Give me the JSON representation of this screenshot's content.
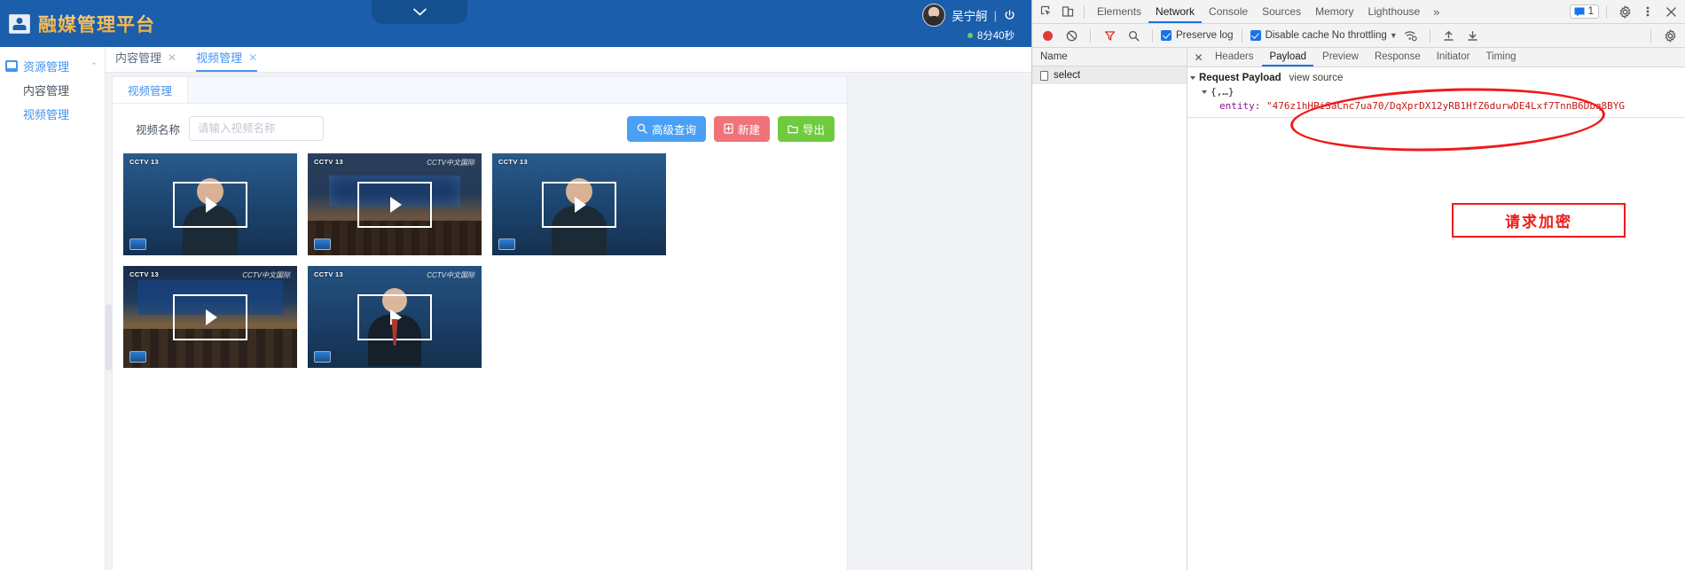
{
  "app": {
    "logo_text": "融媒管理平台",
    "user": {
      "name": "吴宁舸",
      "separator": "|",
      "timer": "8分40秒"
    }
  },
  "sidebar": {
    "group": {
      "label": "资源管理",
      "icon": "resource-icon",
      "chevron": "⌃"
    },
    "items": [
      {
        "label": "内容管理",
        "active": false
      },
      {
        "label": "视频管理",
        "active": true
      }
    ]
  },
  "tabstrip": {
    "tabs": [
      {
        "label": "内容管理",
        "close": "✕",
        "active": false
      },
      {
        "label": "视频管理",
        "close": "✕",
        "active": true
      }
    ]
  },
  "content": {
    "card_tab": "视频管理",
    "filter": {
      "label": "视频名称",
      "placeholder": "请输入视频名称",
      "value": ""
    },
    "buttons": [
      {
        "label": "高级查询",
        "icon": "search-icon",
        "color": "#4aa0f5"
      },
      {
        "label": "新建",
        "icon": "file-plus-icon",
        "color": "#f0737a"
      },
      {
        "label": "导出",
        "icon": "export-folder-icon",
        "color": "#6fcb3e"
      }
    ],
    "videos": [
      {
        "scene": "anchor",
        "cctv": "CCTV 13",
        "watermark": "",
        "play": "play-icon"
      },
      {
        "scene": "hall",
        "cctv": "CCTV 13",
        "watermark": "CCTV中文国际",
        "play": "play-icon"
      },
      {
        "scene": "anchor",
        "cctv": "CCTV 13",
        "watermark": "",
        "play": "play-icon"
      },
      {
        "scene": "stage",
        "cctv": "CCTV 13",
        "watermark": "CCTV中文国际",
        "play": "play-icon"
      },
      {
        "scene": "anchor2",
        "cctv": "CCTV 13",
        "watermark": "CCTV中文国际",
        "play": "play-icon"
      }
    ]
  },
  "devtools": {
    "left_icons": [
      "inspect-icon",
      "device-toolbar-icon"
    ],
    "tabs": [
      {
        "label": "Elements",
        "active": false
      },
      {
        "label": "Network",
        "active": true
      },
      {
        "label": "Console",
        "active": false
      },
      {
        "label": "Sources",
        "active": false
      },
      {
        "label": "Memory",
        "active": false
      },
      {
        "label": "Lighthouse",
        "active": false
      }
    ],
    "more": "»",
    "message_count": "1",
    "settings_icon": "gear-icon",
    "kebab_icon": "kebab-menu-icon",
    "close_icon": "close-icon",
    "toolbar": {
      "record_icon": "record-icon",
      "clear_icon": "clear-icon",
      "filter_icon": "filter-icon",
      "search_icon": "search-icon",
      "preserve_log": "Preserve log",
      "disable_cache": "Disable cache",
      "throttling": "No throttling",
      "wifi_icon": "network-conditions-icon",
      "import_icon": "import-har-icon",
      "export_icon": "export-har-icon",
      "gear_icon": "gear-icon"
    },
    "requests": {
      "column_header": "Name",
      "rows": [
        {
          "name": "select"
        }
      ]
    },
    "detail_tabs": [
      {
        "label": "Headers",
        "active": false
      },
      {
        "label": "Payload",
        "active": true
      },
      {
        "label": "Preview",
        "active": false
      },
      {
        "label": "Response",
        "active": false
      },
      {
        "label": "Initiator",
        "active": false
      },
      {
        "label": "Timing",
        "active": false
      }
    ],
    "payload": {
      "section_title": "Request Payload",
      "view_source": "view source",
      "object_node": "{,…}",
      "entity_key": "entity:",
      "entity_value": "\"476z1hHPiSaCnc7ua70/DqXprDX12yRB1HfZ6durwDE4Lxf7TnnB6Dbq8BYG"
    }
  },
  "annotations": {
    "label": "请求加密",
    "color": "#ee1b1b"
  }
}
